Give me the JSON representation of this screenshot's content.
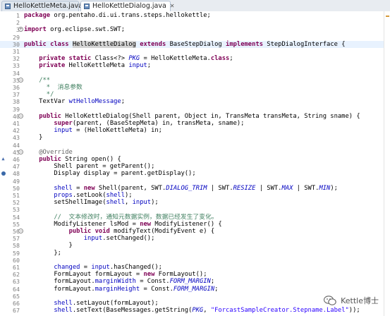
{
  "tabs": [
    {
      "label": "HelloKettleMeta.java",
      "active": false
    },
    {
      "label": "HelloKettleDialog.java",
      "active": true
    }
  ],
  "lines": [
    {
      "n": "1",
      "marker": "",
      "segs": [
        [
          "kw",
          "package"
        ],
        [
          "t",
          " org.pentaho.di.ui.trans.steps.hellokettle;"
        ]
      ]
    },
    {
      "n": "2",
      "marker": "",
      "segs": []
    },
    {
      "n": "3",
      "marker": "fold-plus",
      "segs": [
        [
          "kw",
          "import"
        ],
        [
          "t",
          " org.eclipse.swt.SWT;"
        ]
      ]
    },
    {
      "n": "29",
      "marker": "",
      "segs": []
    },
    {
      "n": "30",
      "marker": "",
      "current": true,
      "segs": [
        [
          "kw",
          "public class"
        ],
        [
          "t",
          " "
        ],
        [
          "hl",
          "HelloKettleDialog"
        ],
        [
          "t",
          " "
        ],
        [
          "kw",
          "extends"
        ],
        [
          "t",
          " BaseStepDialog "
        ],
        [
          "kw",
          "implements"
        ],
        [
          "t",
          " StepDialogInterface {"
        ]
      ]
    },
    {
      "n": "31",
      "marker": "",
      "segs": []
    },
    {
      "n": "32",
      "marker": "",
      "segs": [
        [
          "t",
          "    "
        ],
        [
          "kw",
          "private static"
        ],
        [
          "t",
          " Class<?> "
        ],
        [
          "sfld",
          "PKG"
        ],
        [
          "t",
          " = HelloKettleMeta."
        ],
        [
          "kw",
          "class"
        ],
        [
          "t",
          ";"
        ]
      ]
    },
    {
      "n": "33",
      "marker": "",
      "segs": [
        [
          "t",
          "    "
        ],
        [
          "kw",
          "private"
        ],
        [
          "t",
          " HelloKettleMeta "
        ],
        [
          "fld",
          "input"
        ],
        [
          "t",
          ";"
        ]
      ]
    },
    {
      "n": "34",
      "marker": "",
      "segs": []
    },
    {
      "n": "35",
      "marker": "fold-minus",
      "segs": [
        [
          "t",
          "    "
        ],
        [
          "cm",
          "/**"
        ]
      ]
    },
    {
      "n": "36",
      "marker": "",
      "segs": [
        [
          "t",
          "    "
        ],
        [
          "cm",
          "  *  消息参数"
        ]
      ]
    },
    {
      "n": "37",
      "marker": "",
      "segs": [
        [
          "t",
          "    "
        ],
        [
          "cm",
          "  */"
        ]
      ]
    },
    {
      "n": "38",
      "marker": "",
      "segs": [
        [
          "t",
          "    TextVar "
        ],
        [
          "fld",
          "wtHelloMessage"
        ],
        [
          "t",
          ";"
        ]
      ]
    },
    {
      "n": "39",
      "marker": "",
      "segs": []
    },
    {
      "n": "40",
      "marker": "fold-minus",
      "segs": [
        [
          "t",
          "    "
        ],
        [
          "kw",
          "public"
        ],
        [
          "t",
          " HelloKettleDialog(Shell parent, Object in, TransMeta transMeta, String sname) {"
        ]
      ]
    },
    {
      "n": "41",
      "marker": "",
      "segs": [
        [
          "t",
          "        "
        ],
        [
          "kw",
          "super"
        ],
        [
          "t",
          "(parent, (BaseStepMeta) in, transMeta, sname);"
        ]
      ]
    },
    {
      "n": "42",
      "marker": "",
      "segs": [
        [
          "t",
          "        "
        ],
        [
          "fld",
          "input"
        ],
        [
          "t",
          " = (HelloKettleMeta) in;"
        ]
      ]
    },
    {
      "n": "43",
      "marker": "",
      "segs": [
        [
          "t",
          "    }"
        ]
      ]
    },
    {
      "n": "44",
      "marker": "",
      "segs": []
    },
    {
      "n": "45",
      "marker": "fold-minus",
      "segs": [
        [
          "t",
          "    "
        ],
        [
          "ann",
          "@Override"
        ]
      ]
    },
    {
      "n": "46",
      "marker": "override",
      "segs": [
        [
          "t",
          "    "
        ],
        [
          "kw",
          "public"
        ],
        [
          "t",
          " String open() {"
        ]
      ]
    },
    {
      "n": "47",
      "marker": "",
      "segs": [
        [
          "t",
          "        Shell parent = getParent();"
        ]
      ]
    },
    {
      "n": "48",
      "marker": "impl",
      "segs": [
        [
          "t",
          "        Display display = parent.getDisplay();"
        ]
      ]
    },
    {
      "n": "49",
      "marker": "",
      "segs": []
    },
    {
      "n": "50",
      "marker": "",
      "segs": [
        [
          "t",
          "        "
        ],
        [
          "fld",
          "shell"
        ],
        [
          "t",
          " = "
        ],
        [
          "kw",
          "new"
        ],
        [
          "t",
          " Shell(parent, SWT."
        ],
        [
          "sfld",
          "DIALOG_TRIM"
        ],
        [
          "t",
          " | SWT."
        ],
        [
          "sfld",
          "RESIZE"
        ],
        [
          "t",
          " | SWT."
        ],
        [
          "sfld",
          "MAX"
        ],
        [
          "t",
          " | SWT."
        ],
        [
          "sfld",
          "MIN"
        ],
        [
          "t",
          ");"
        ]
      ]
    },
    {
      "n": "51",
      "marker": "",
      "segs": [
        [
          "t",
          "        "
        ],
        [
          "fld",
          "props"
        ],
        [
          "t",
          ".setLook("
        ],
        [
          "fld",
          "shell"
        ],
        [
          "t",
          ");"
        ]
      ]
    },
    {
      "n": "52",
      "marker": "",
      "segs": [
        [
          "t",
          "        setShellImage("
        ],
        [
          "fld",
          "shell"
        ],
        [
          "t",
          ", "
        ],
        [
          "fld",
          "input"
        ],
        [
          "t",
          ");"
        ]
      ]
    },
    {
      "n": "53",
      "marker": "",
      "segs": []
    },
    {
      "n": "54",
      "marker": "",
      "segs": [
        [
          "t",
          "        "
        ],
        [
          "cm",
          "//  文本修改时，通知元数据实例，数据已经发生了变化。"
        ]
      ]
    },
    {
      "n": "55",
      "marker": "",
      "segs": [
        [
          "t",
          "        ModifyListener lsMod = "
        ],
        [
          "kw",
          "new"
        ],
        [
          "t",
          " ModifyListener() {"
        ]
      ]
    },
    {
      "n": "56",
      "marker": "fold-minus",
      "segs": [
        [
          "t",
          "            "
        ],
        [
          "kw",
          "public void"
        ],
        [
          "t",
          " modifyText(ModifyEvent e) {"
        ]
      ]
    },
    {
      "n": "57",
      "marker": "",
      "segs": [
        [
          "t",
          "                "
        ],
        [
          "fld",
          "input"
        ],
        [
          "t",
          ".setChanged();"
        ]
      ]
    },
    {
      "n": "58",
      "marker": "",
      "segs": [
        [
          "t",
          "            }"
        ]
      ]
    },
    {
      "n": "59",
      "marker": "",
      "segs": [
        [
          "t",
          "        };"
        ]
      ]
    },
    {
      "n": "60",
      "marker": "",
      "segs": []
    },
    {
      "n": "61",
      "marker": "",
      "segs": [
        [
          "t",
          "        "
        ],
        [
          "fld",
          "changed"
        ],
        [
          "t",
          " = "
        ],
        [
          "fld",
          "input"
        ],
        [
          "t",
          ".hasChanged();"
        ]
      ]
    },
    {
      "n": "62",
      "marker": "",
      "segs": [
        [
          "t",
          "        FormLayout formLayout = "
        ],
        [
          "kw",
          "new"
        ],
        [
          "t",
          " FormLayout();"
        ]
      ]
    },
    {
      "n": "63",
      "marker": "",
      "segs": [
        [
          "t",
          "        formLayout."
        ],
        [
          "fld",
          "marginWidth"
        ],
        [
          "t",
          " = Const."
        ],
        [
          "sfld",
          "FORM_MARGIN"
        ],
        [
          "t",
          ";"
        ]
      ]
    },
    {
      "n": "64",
      "marker": "",
      "segs": [
        [
          "t",
          "        formLayout."
        ],
        [
          "fld",
          "marginHeight"
        ],
        [
          "t",
          " = Const."
        ],
        [
          "sfld",
          "FORM_MARGIN"
        ],
        [
          "t",
          ";"
        ]
      ]
    },
    {
      "n": "65",
      "marker": "",
      "segs": []
    },
    {
      "n": "66",
      "marker": "",
      "segs": [
        [
          "t",
          "        "
        ],
        [
          "fld",
          "shell"
        ],
        [
          "t",
          ".setLayout(formLayout);"
        ]
      ]
    },
    {
      "n": "67",
      "marker": "",
      "segs": [
        [
          "t",
          "        "
        ],
        [
          "fld",
          "shell"
        ],
        [
          "t",
          ".setText(BaseMessages.getString("
        ],
        [
          "sfld",
          "PKG"
        ],
        [
          "t",
          ", "
        ],
        [
          "str",
          "\"ForcastSampleCreator.Stepname.Label\""
        ],
        [
          "t",
          "));"
        ]
      ]
    }
  ],
  "watermark": {
    "text": "Kettle博士"
  },
  "colors": {
    "keyword": "#7f0055",
    "comment": "#3f7f5f",
    "field": "#0000c0",
    "string": "#2a00ff",
    "annotation": "#646464",
    "current_line": "#e8f2fe",
    "line_number": "#7f7f7f"
  }
}
